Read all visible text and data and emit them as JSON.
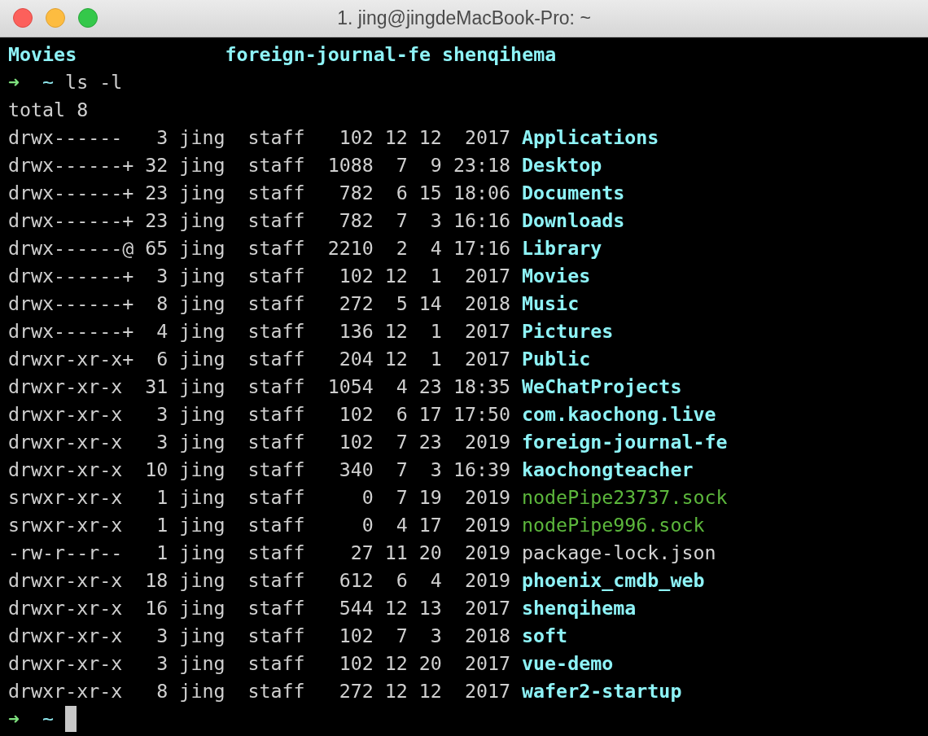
{
  "window": {
    "title": "1. jing@jingdeMacBook-Pro: ~"
  },
  "terminal": {
    "lines": [
      {
        "kind": "columns",
        "entries": [
          {
            "name": "Movies",
            "kind": "dir"
          },
          {
            "name": "foreign-journal-fe",
            "kind": "dir"
          },
          {
            "name": "shenqihema",
            "kind": "dir"
          }
        ]
      },
      {
        "kind": "prompt",
        "arrow": "➜",
        "cwd": "~",
        "command": "ls -l",
        "cursor": false
      },
      {
        "kind": "text",
        "text": "total 8"
      },
      {
        "kind": "entry",
        "mode": "drwx------",
        "links": "3",
        "owner": "jing",
        "group": "staff",
        "size": "102",
        "month": "12",
        "day": "12",
        "time": "2017",
        "file": {
          "name": "Applications",
          "kind": "dir"
        }
      },
      {
        "kind": "entry",
        "mode": "drwx------+",
        "links": "32",
        "owner": "jing",
        "group": "staff",
        "size": "1088",
        "month": "7",
        "day": "9",
        "time": "23:18",
        "file": {
          "name": "Desktop",
          "kind": "dir"
        }
      },
      {
        "kind": "entry",
        "mode": "drwx------+",
        "links": "23",
        "owner": "jing",
        "group": "staff",
        "size": "782",
        "month": "6",
        "day": "15",
        "time": "18:06",
        "file": {
          "name": "Documents",
          "kind": "dir"
        }
      },
      {
        "kind": "entry",
        "mode": "drwx------+",
        "links": "23",
        "owner": "jing",
        "group": "staff",
        "size": "782",
        "month": "7",
        "day": "3",
        "time": "16:16",
        "file": {
          "name": "Downloads",
          "kind": "dir"
        }
      },
      {
        "kind": "entry",
        "mode": "drwx------@",
        "links": "65",
        "owner": "jing",
        "group": "staff",
        "size": "2210",
        "month": "2",
        "day": "4",
        "time": "17:16",
        "file": {
          "name": "Library",
          "kind": "dir"
        }
      },
      {
        "kind": "entry",
        "mode": "drwx------+",
        "links": "3",
        "owner": "jing",
        "group": "staff",
        "size": "102",
        "month": "12",
        "day": "1",
        "time": "2017",
        "file": {
          "name": "Movies",
          "kind": "dir"
        }
      },
      {
        "kind": "entry",
        "mode": "drwx------+",
        "links": "8",
        "owner": "jing",
        "group": "staff",
        "size": "272",
        "month": "5",
        "day": "14",
        "time": "2018",
        "file": {
          "name": "Music",
          "kind": "dir"
        }
      },
      {
        "kind": "entry",
        "mode": "drwx------+",
        "links": "4",
        "owner": "jing",
        "group": "staff",
        "size": "136",
        "month": "12",
        "day": "1",
        "time": "2017",
        "file": {
          "name": "Pictures",
          "kind": "dir"
        }
      },
      {
        "kind": "entry",
        "mode": "drwxr-xr-x+",
        "links": "6",
        "owner": "jing",
        "group": "staff",
        "size": "204",
        "month": "12",
        "day": "1",
        "time": "2017",
        "file": {
          "name": "Public",
          "kind": "dir"
        }
      },
      {
        "kind": "entry",
        "mode": "drwxr-xr-x",
        "links": "31",
        "owner": "jing",
        "group": "staff",
        "size": "1054",
        "month": "4",
        "day": "23",
        "time": "18:35",
        "file": {
          "name": "WeChatProjects",
          "kind": "dir"
        }
      },
      {
        "kind": "entry",
        "mode": "drwxr-xr-x",
        "links": "3",
        "owner": "jing",
        "group": "staff",
        "size": "102",
        "month": "6",
        "day": "17",
        "time": "17:50",
        "file": {
          "name": "com.kaochong.live",
          "kind": "dir"
        }
      },
      {
        "kind": "entry",
        "mode": "drwxr-xr-x",
        "links": "3",
        "owner": "jing",
        "group": "staff",
        "size": "102",
        "month": "7",
        "day": "23",
        "time": "2019",
        "file": {
          "name": "foreign-journal-fe",
          "kind": "dir"
        }
      },
      {
        "kind": "entry",
        "mode": "drwxr-xr-x",
        "links": "10",
        "owner": "jing",
        "group": "staff",
        "size": "340",
        "month": "7",
        "day": "3",
        "time": "16:39",
        "file": {
          "name": "kaochongteacher",
          "kind": "dir"
        }
      },
      {
        "kind": "entry",
        "mode": "srwxr-xr-x",
        "links": "1",
        "owner": "jing",
        "group": "staff",
        "size": "0",
        "month": "7",
        "day": "19",
        "time": "2019",
        "file": {
          "name": "nodePipe23737.sock",
          "kind": "socket"
        }
      },
      {
        "kind": "entry",
        "mode": "srwxr-xr-x",
        "links": "1",
        "owner": "jing",
        "group": "staff",
        "size": "0",
        "month": "4",
        "day": "17",
        "time": "2019",
        "file": {
          "name": "nodePipe996.sock",
          "kind": "socket"
        }
      },
      {
        "kind": "entry",
        "mode": "-rw-r--r--",
        "links": "1",
        "owner": "jing",
        "group": "staff",
        "size": "27",
        "month": "11",
        "day": "20",
        "time": "2019",
        "file": {
          "name": "package-lock.json",
          "kind": "file"
        }
      },
      {
        "kind": "entry",
        "mode": "drwxr-xr-x",
        "links": "18",
        "owner": "jing",
        "group": "staff",
        "size": "612",
        "month": "6",
        "day": "4",
        "time": "2019",
        "file": {
          "name": "phoenix_cmdb_web",
          "kind": "dir"
        }
      },
      {
        "kind": "entry",
        "mode": "drwxr-xr-x",
        "links": "16",
        "owner": "jing",
        "group": "staff",
        "size": "544",
        "month": "12",
        "day": "13",
        "time": "2017",
        "file": {
          "name": "shenqihema",
          "kind": "dir"
        }
      },
      {
        "kind": "entry",
        "mode": "drwxr-xr-x",
        "links": "3",
        "owner": "jing",
        "group": "staff",
        "size": "102",
        "month": "7",
        "day": "3",
        "time": "2018",
        "file": {
          "name": "soft",
          "kind": "dir"
        }
      },
      {
        "kind": "entry",
        "mode": "drwxr-xr-x",
        "links": "3",
        "owner": "jing",
        "group": "staff",
        "size": "102",
        "month": "12",
        "day": "20",
        "time": "2017",
        "file": {
          "name": "vue-demo",
          "kind": "dir"
        }
      },
      {
        "kind": "entry",
        "mode": "drwxr-xr-x",
        "links": "8",
        "owner": "jing",
        "group": "staff",
        "size": "272",
        "month": "12",
        "day": "12",
        "time": "2017",
        "file": {
          "name": "wafer2-startup",
          "kind": "dir"
        }
      },
      {
        "kind": "prompt",
        "arrow": "➜",
        "cwd": "~",
        "cursor": true
      }
    ]
  }
}
